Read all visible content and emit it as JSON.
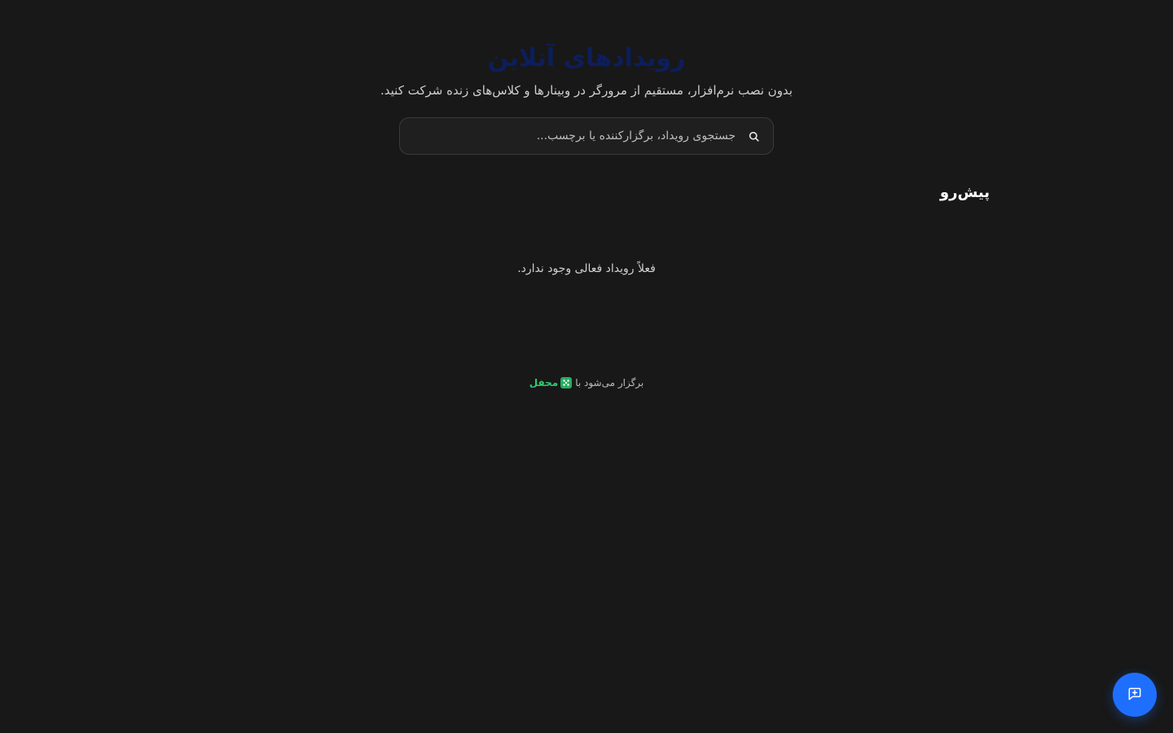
{
  "hero": {
    "title": "رویدادهای آنلاین",
    "subtitle": "بدون نصب نرم‌افزار، مستقیم از مرورگر در وبینارها و کلاس‌های زنده شرکت کنید."
  },
  "search": {
    "placeholder": "جستجوی رویداد، برگزارکننده یا برچسب...",
    "value": "",
    "icon": "search-icon"
  },
  "upcoming": {
    "title": "پیش‌رو",
    "empty_message": "فعلاً رویداد فعالی وجود ندارد."
  },
  "footer": {
    "prefix": "برگزار می‌شود با",
    "brand": "محفل",
    "brand_color": "#2ecc71"
  },
  "chat_button": {
    "icon": "chat-add-icon",
    "color": "#1f6fff"
  },
  "colors": {
    "background": "#181818",
    "title": "#0c1e5c",
    "accent": "#1f6fff"
  }
}
